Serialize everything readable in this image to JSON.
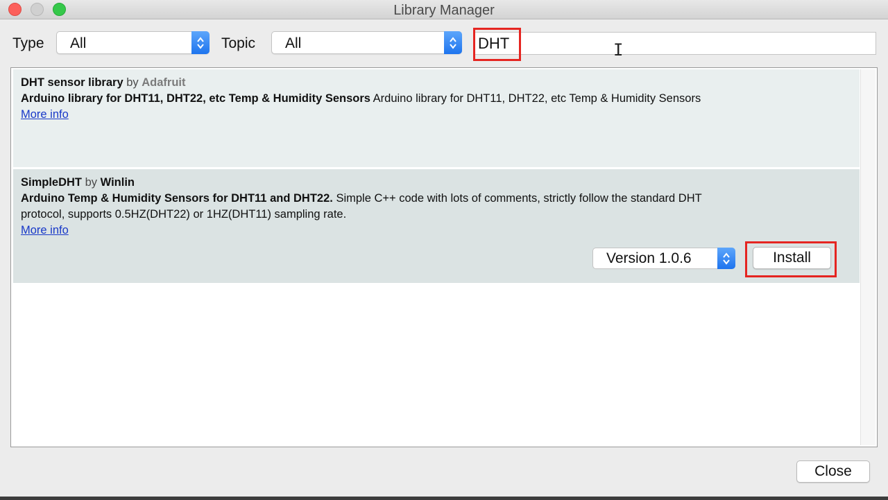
{
  "window": {
    "title": "Library Manager"
  },
  "filters": {
    "type_label": "Type",
    "type_value": "All",
    "topic_label": "Topic",
    "topic_value": "All",
    "search_value": "DHT"
  },
  "libraries": [
    {
      "name": "DHT sensor library",
      "by": "by",
      "author": "Adafruit",
      "sentence": "Arduino library for DHT11, DHT22, etc Temp & Humidity Sensors",
      "paragraph": "Arduino library for DHT11, DHT22, etc Temp & Humidity Sensors",
      "more_info": "More info"
    },
    {
      "name": "SimpleDHT",
      "by": "by",
      "author": "Winlin",
      "sentence": "Arduino Temp & Humidity Sensors for DHT11 and DHT22.",
      "paragraph_line1": "Simple C++ code with lots of comments, strictly follow the standard DHT",
      "paragraph_line2": "protocol, supports 0.5HZ(DHT22) or 1HZ(DHT11) sampling rate.",
      "more_info": "More info",
      "version": "Version 1.0.6",
      "install_label": "Install"
    }
  ],
  "footer": {
    "close_label": "Close"
  },
  "colors": {
    "highlight": "#e52521",
    "link": "#1838c8",
    "select_accent": "#1e74ee"
  },
  "icons": {
    "select_arrows": "up-down-chevron-icon",
    "text_cursor": "i-beam-cursor-icon"
  }
}
